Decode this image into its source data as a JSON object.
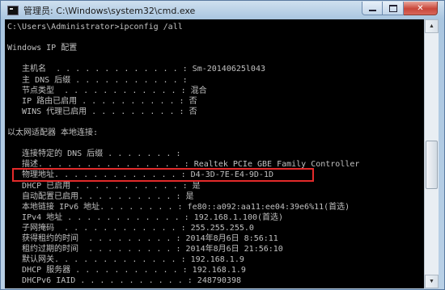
{
  "window": {
    "title": "管理员: C:\\Windows\\system32\\cmd.exe",
    "minimize_icon": "minimize-icon",
    "maximize_icon": "maximize-icon",
    "close_label": "✕"
  },
  "console": {
    "lines": [
      "C:\\Users\\Administrator>ipconfig /all",
      "",
      "Windows IP 配置",
      "",
      "   主机名  . . . . . . . . . . . . . : Sm-20140625l043",
      "   主 DNS 后缀 . . . . . . . . . . . :",
      "   节点类型  . . . . . . . . . . . . : 混合",
      "   IP 路由已启用 . . . . . . . . . . : 否",
      "   WINS 代理已启用 . . . . . . . . . : 否",
      "",
      "以太网适配器 本地连接:",
      "",
      "   连接特定的 DNS 后缀 . . . . . . . :",
      "   描述. . . . . . . . . . . . . . . : Realtek PCIe GBE Family Controller",
      "   物理地址. . . . . . . . . . . . . : D4-3D-7E-E4-9D-1D",
      "   DHCP 已启用 . . . . . . . . . . . : 是",
      "   自动配置已启用. . . . . . . . . . : 是",
      "   本地链接 IPv6 地址. . . . . . . . : fe80::a092:aa11:ee04:39e6%11(首选)",
      "   IPv4 地址 . . . . . . . . . . . . : 192.168.1.100(首选)",
      "   子网掩码  . . . . . . . . . . . . : 255.255.255.0",
      "   获得租约的时间  . . . . . . . . . : 2014年8月6日 8:56:11",
      "   租约过期的时间  . . . . . . . . . : 2014年8月6日 21:56:10",
      "   默认网关. . . . . . . . . . . . . : 192.168.1.9",
      "   DHCP 服务器 . . . . . . . . . . . : 192.168.1.9",
      "   DHCPv6 IAID . . . . . . . . . . . : 248790398"
    ],
    "highlighted_line_index": 14,
    "highlight_color": "#e32a2a",
    "text_color": "#c0c0c0",
    "background_color": "#000000"
  },
  "scrollbar": {
    "up_arrow": "▲",
    "down_arrow": "▼"
  }
}
